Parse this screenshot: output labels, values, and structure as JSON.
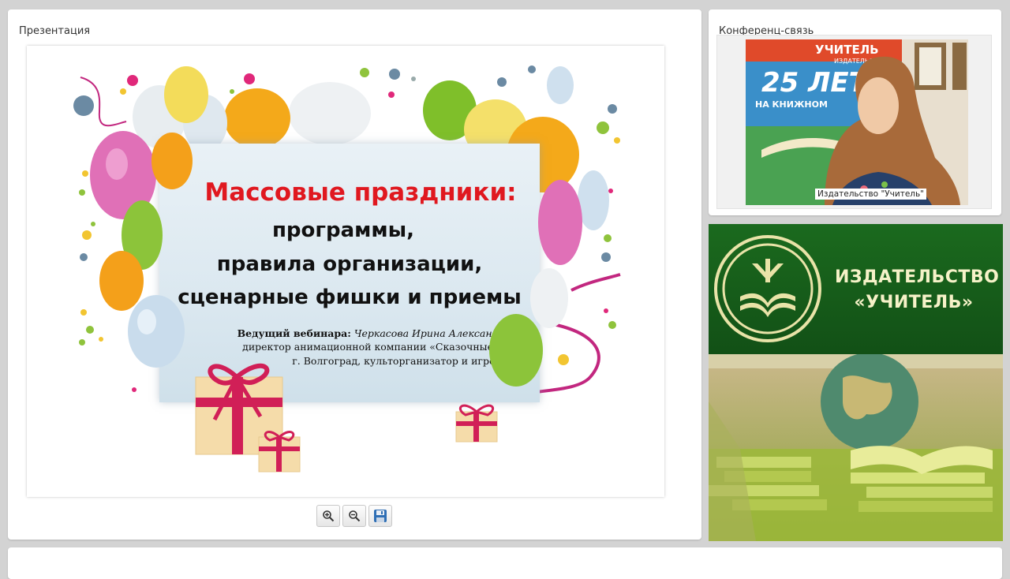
{
  "presentation": {
    "title": "Презентация",
    "slide": {
      "headline": "Массовые праздники:",
      "lines": [
        "программы,",
        "правила организации,",
        "сценарные фишки и приемы"
      ],
      "host_label": "Ведущий вебинара:",
      "host_name": "Черкасова Ирина Александровна,",
      "host_role": "директор анимационной компании «Сказочные Люди»",
      "host_city": "г. Волгоград, культорганизатор и игромастер",
      "colors": {
        "headline": "#e0181f",
        "text": "#111111"
      }
    },
    "toolbar": {
      "zoom_in_icon": "zoom-in-icon",
      "zoom_out_icon": "zoom-out-icon",
      "save_icon": "save-icon"
    }
  },
  "conference": {
    "title": "Конференц-связь",
    "caption": "Издательство \"Учитель\"",
    "banner": {
      "line1": "УЧИТЕЛЬ",
      "line2": "ИЗДАТЕЛЬСТВО",
      "line3": "25 ЛЕТ",
      "line4": "НА КНИЖНОМ"
    }
  },
  "promo": {
    "name_line1": "ИЗДАТЕЛЬСТВО",
    "name_line2": "«УЧИТЕЛЬ»",
    "colors": {
      "green": "#1b6a1e",
      "text": "#f6f2c8"
    }
  }
}
